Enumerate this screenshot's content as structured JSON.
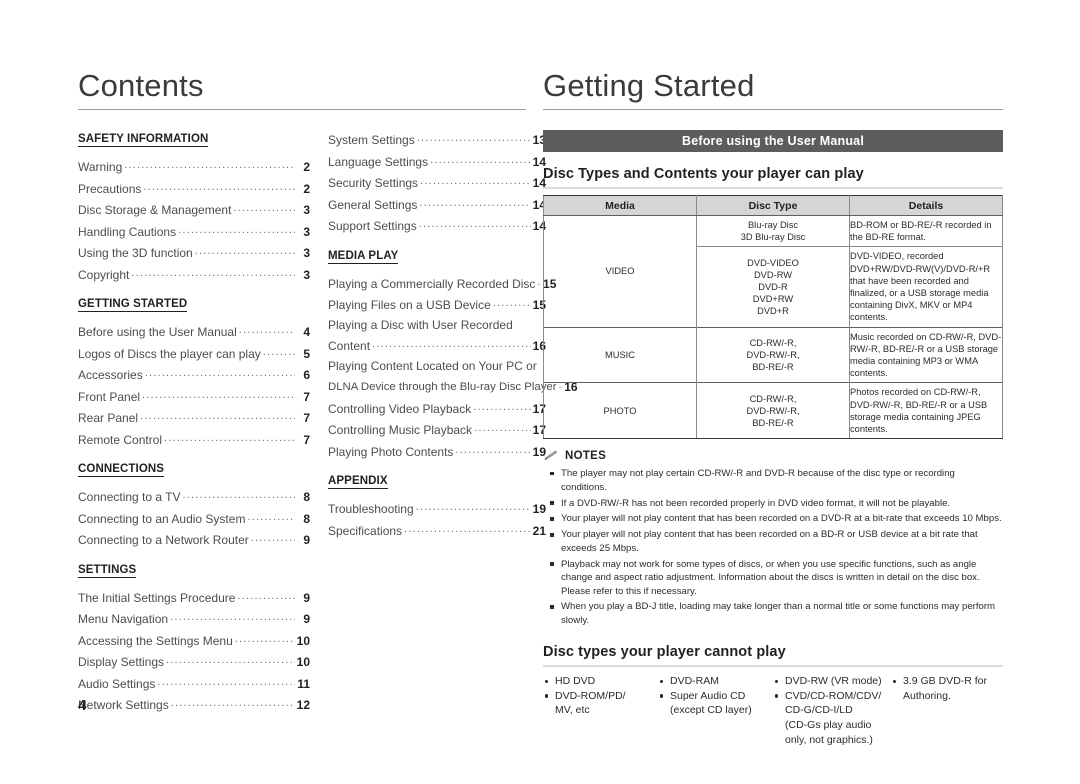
{
  "left_page": {
    "title": "Contents",
    "columns": [
      {
        "sections": [
          {
            "heading": "SAFETY INFORMATION",
            "entries": [
              {
                "label": "Warning",
                "page": "2"
              },
              {
                "label": "Precautions",
                "page": "2"
              },
              {
                "label": "Disc Storage & Management",
                "page": "3"
              },
              {
                "label": "Handling Cautions",
                "page": "3"
              },
              {
                "label": "Using the 3D function",
                "page": "3"
              },
              {
                "label": "Copyright",
                "page": "3"
              }
            ]
          },
          {
            "heading": "GETTING STARTED",
            "entries": [
              {
                "label": "Before using the User Manual",
                "page": "4"
              },
              {
                "label": "Logos of Discs the player can play",
                "page": "5"
              },
              {
                "label": "Accessories",
                "page": "6"
              },
              {
                "label": "Front Panel",
                "page": "7"
              },
              {
                "label": "Rear Panel",
                "page": "7"
              },
              {
                "label": "Remote Control",
                "page": "7"
              }
            ]
          },
          {
            "heading": "CONNECTIONS",
            "entries": [
              {
                "label": "Connecting to a TV",
                "page": "8"
              },
              {
                "label": "Connecting to an Audio System",
                "page": "8"
              },
              {
                "label": "Connecting to a Network Router",
                "page": "9"
              }
            ]
          },
          {
            "heading": "SETTINGS",
            "entries": [
              {
                "label": "The Initial Settings Procedure",
                "page": "9"
              },
              {
                "label": "Menu Navigation",
                "page": "9"
              },
              {
                "label": "Accessing the Settings Menu",
                "page": "10"
              },
              {
                "label": "Display Settings",
                "page": "10"
              },
              {
                "label": "Audio Settings",
                "page": "11"
              },
              {
                "label": "Network Settings",
                "page": "12"
              }
            ]
          }
        ]
      },
      {
        "sections": [
          {
            "heading": "",
            "entries": [
              {
                "label": "System Settings",
                "page": "13"
              },
              {
                "label": "Language Settings",
                "page": "14"
              },
              {
                "label": "Security Settings",
                "page": "14"
              },
              {
                "label": "General Settings",
                "page": "14"
              },
              {
                "label": "Support Settings",
                "page": "14"
              }
            ]
          },
          {
            "heading": "MEDIA PLAY",
            "entries": [
              {
                "label": "Playing a Commercially Recorded Disc",
                "page": "15"
              },
              {
                "label": "Playing Files on a USB Device",
                "page": "15"
              },
              {
                "label": "Playing a Disc with User Recorded",
                "line2": "Content",
                "page": "16"
              },
              {
                "label": "Playing Content Located on Your PC or",
                "line2": "DLNA Device through the Blu-ray Disc Player",
                "page": "16"
              },
              {
                "label": "Controlling Video Playback",
                "page": "17"
              },
              {
                "label": "Controlling Music Playback",
                "page": "17"
              },
              {
                "label": "Playing Photo Contents",
                "page": "19"
              }
            ]
          },
          {
            "heading": "APPENDIX",
            "entries": [
              {
                "label": "Troubleshooting",
                "page": "19"
              },
              {
                "label": "Specifications",
                "page": "21"
              }
            ]
          }
        ]
      }
    ]
  },
  "right_page": {
    "title": "Getting Started",
    "band_label": "Before using the User Manual",
    "section_heading": "Disc Types and Contents your player can play",
    "table": {
      "headers": [
        "Media",
        "Disc Type",
        "Details"
      ],
      "rows": [
        {
          "media": "VIDEO",
          "media_rowspan": 2,
          "type": "Blu-ray Disc\n3D Blu-ray Disc",
          "details": "BD-ROM or BD-RE/-R recorded in the BD-RE format."
        },
        {
          "media": "",
          "type": "DVD-VIDEO\nDVD-RW\nDVD-R\nDVD+RW\nDVD+R",
          "details": "DVD-VIDEO, recorded DVD+RW/DVD-RW(V)/DVD-R/+R that have been recorded and finalized, or a USB storage media containing DivX, MKV or MP4 contents."
        },
        {
          "media": "MUSIC",
          "type": "CD-RW/-R,\nDVD-RW/-R,\nBD-RE/-R",
          "details": "Music recorded on CD-RW/-R, DVD-RW/-R, BD-RE/-R or a USB storage media containing MP3 or WMA contents."
        },
        {
          "media": "PHOTO",
          "type": "CD-RW/-R,\nDVD-RW/-R,\nBD-RE/-R",
          "details": "Photos recorded on CD-RW/-R, DVD-RW/-R, BD-RE/-R or a USB storage media containing JPEG contents."
        }
      ]
    },
    "notes": {
      "icon": "pencil-icon",
      "title": "NOTES",
      "items": [
        "The player may not play certain CD-RW/-R and DVD-R because of the disc type or recording conditions.",
        "If a DVD-RW/-R has not been recorded properly in DVD video format, it will not be playable.",
        "Your player will not play content that has been recorded on a DVD-R at a bit-rate that exceeds 10 Mbps.",
        "Your player will not play content that has been recorded on a BD-R or USB device at a bit rate that exceeds 25 Mbps.",
        "Playback may not work for some types of discs, or when you use specific functions, such as angle change and aspect ratio adjustment. Information about the discs is written in detail on the disc box. Please refer to this if necessary.",
        "When you play a BD-J title, loading may take longer than a normal title or some functions may perform slowly."
      ]
    },
    "cannot_play": {
      "heading": "Disc types your player cannot play",
      "columns": [
        [
          {
            "text": "HD DVD"
          },
          {
            "text": "DVD-ROM/PD/",
            "continuation": "MV, etc"
          }
        ],
        [
          {
            "text": "DVD-RAM"
          },
          {
            "text": "Super Audio CD",
            "continuation": "(except CD layer)"
          }
        ],
        [
          {
            "text": "DVD-RW (VR mode)"
          },
          {
            "text": "CVD/CD-ROM/CDV/",
            "continuation": "CD-G/CD-I/LD\n(CD-Gs play audio\nonly, not graphics.)"
          }
        ],
        [
          {
            "text": "3.9 GB DVD-R for",
            "continuation": "Authoring."
          }
        ]
      ]
    }
  },
  "folio": "4",
  "colors": {
    "band_bg": "#5d5d5d",
    "table_header_bg": "#d5d5d5",
    "rule": "#9b9b9b",
    "text": "#231f20"
  }
}
